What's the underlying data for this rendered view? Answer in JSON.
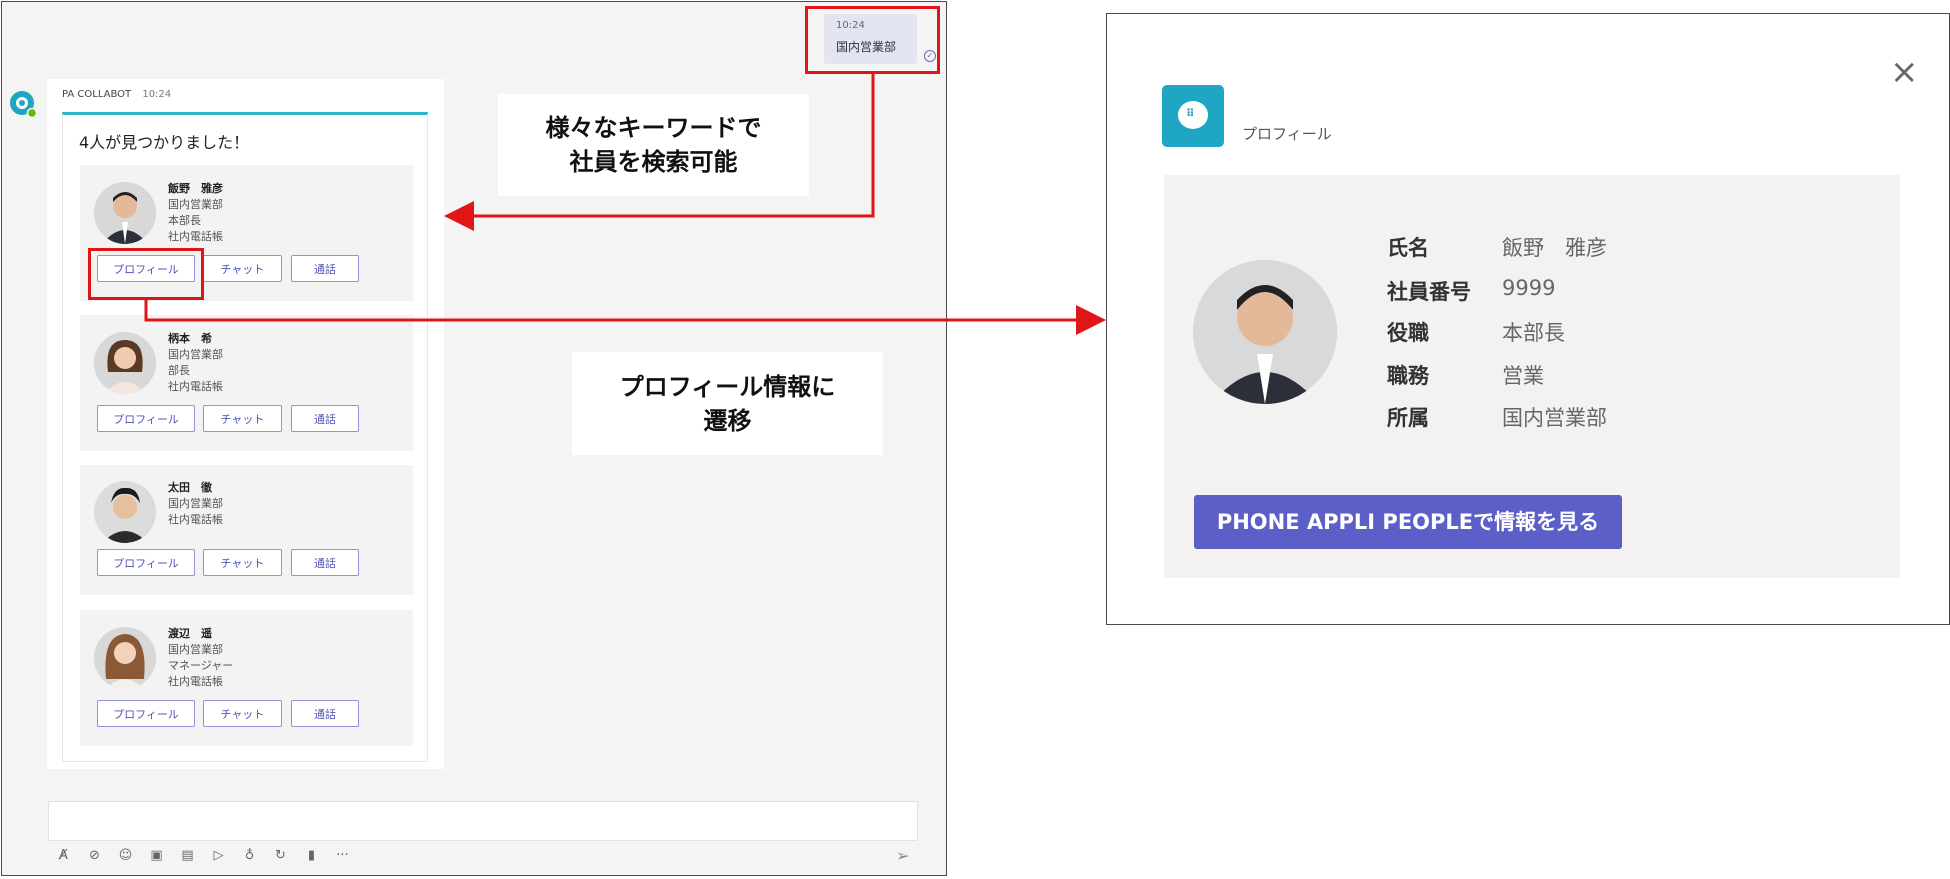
{
  "chat": {
    "user_message": {
      "time": "10:24",
      "text": "国内営業部"
    },
    "bot": {
      "name": "PA COLLABOT",
      "time": "10:24",
      "result_text": "4人が見つかりました！"
    },
    "buttons": {
      "profile": "プロフィール",
      "chat": "チャット",
      "call": "通話"
    },
    "people": [
      {
        "lines": [
          "飯野　雅彦",
          "国内営業部",
          "本部長",
          "社内電話帳"
        ]
      },
      {
        "lines": [
          "柄本　希",
          "国内営業部",
          "部長",
          "社内電話帳"
        ]
      },
      {
        "lines": [
          "太田　徹",
          "国内営業部",
          "社内電話帳"
        ]
      },
      {
        "lines": [
          "渡辺　遥",
          "国内営業部",
          "マネージャー",
          "社内電話帳"
        ]
      }
    ],
    "compose_icons": [
      "format-icon",
      "attach-icon",
      "emoji-icon",
      "gif-icon",
      "sticker-icon",
      "meet-icon",
      "praise-icon",
      "loop-icon",
      "apps-icon",
      "more-icon"
    ]
  },
  "annotations": {
    "search_callout": "様々なキーワードで\n社員を検索可能",
    "profile_callout": "プロフィール情報に\n遷移"
  },
  "profile": {
    "title": "プロフィール",
    "fields": [
      {
        "label": "氏名",
        "value": "飯野　雅彦"
      },
      {
        "label": "社員番号",
        "value": "9999"
      },
      {
        "label": "役職",
        "value": "本部長"
      },
      {
        "label": "職務",
        "value": "営業"
      },
      {
        "label": "所属",
        "value": "国内営業部"
      }
    ],
    "button_label": "PHONE APPLI PEOPLEで情報を見る"
  },
  "colors": {
    "accent": "#5b5fc7",
    "annotation_red": "#e01515",
    "teal": "#2bb3c6"
  }
}
